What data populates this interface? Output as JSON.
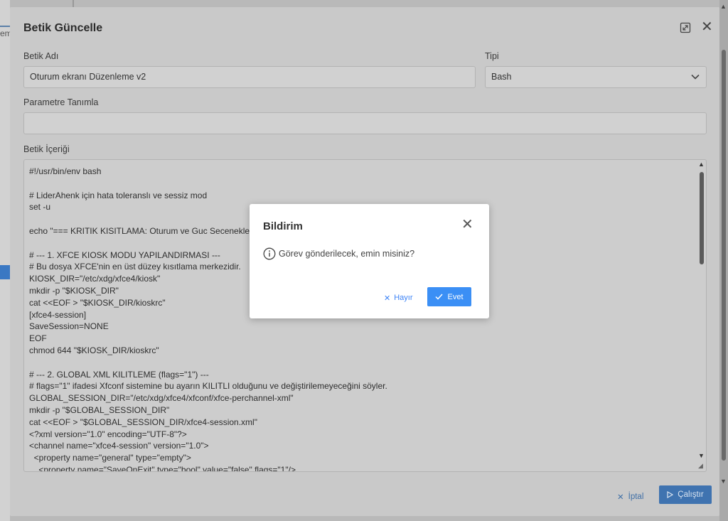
{
  "background": {
    "partial_text": "em"
  },
  "dialog": {
    "title": "Betik Güncelle",
    "name_label": "Betik Adı",
    "name_value": "Oturum ekranı Düzenleme v2",
    "type_label": "Tipi",
    "type_value": "Bash",
    "param_label": "Parametre Tanımla",
    "param_value": "",
    "content_label": "Betik İçeriği",
    "content": "#!/usr/bin/env bash\n\n# LiderAhenk için hata toleranslı ve sessiz mod\nset -u\n\necho \"=== KRITIK KISITLAMA: Oturum ve Guc Secenekleri\n\n# --- 1. XFCE KIOSK MODU YAPILANDIRMASI ---\n# Bu dosya XFCE'nin en üst düzey kısıtlama merkezidir.\nKIOSK_DIR=\"/etc/xdg/xfce4/kiosk\"\nmkdir -p \"$KIOSK_DIR\"\ncat <<EOF > \"$KIOSK_DIR/kioskrc\"\n[xfce4-session]\nSaveSession=NONE\nEOF\nchmod 644 \"$KIOSK_DIR/kioskrc\"\n\n# --- 2. GLOBAL XML KILITLEME (flags=\"1\") ---\n# flags=\"1\" ifadesi Xfconf sistemine bu ayarın KILITLI olduğunu ve değiştirilemeyeceğini söyler.\nGLOBAL_SESSION_DIR=\"/etc/xdg/xfce4/xfconf/xfce-perchannel-xml\"\nmkdir -p \"$GLOBAL_SESSION_DIR\"\ncat <<EOF > \"$GLOBAL_SESSION_DIR/xfce4-session.xml\"\n<?xml version=\"1.0\" encoding=\"UTF-8\"?>\n<channel name=\"xfce4-session\" version=\"1.0\">\n  <property name=\"general\" type=\"empty\">\n    <property name=\"SaveOnExit\" type=\"bool\" value=\"false\" flags=\"1\"/>",
    "cancel_label": "İptal",
    "run_label": "Çalıştır"
  },
  "notification": {
    "title": "Bildirim",
    "message": "Görev gönderilecek, emin misiniz?",
    "no_label": "Hayır",
    "yes_label": "Evet"
  },
  "colors": {
    "primary": "#3b8ff5",
    "overlay": "#8a8a8a"
  },
  "icons": [
    "expand-icon",
    "close-icon",
    "chevron-down-icon",
    "info-icon",
    "x-icon",
    "check-icon",
    "play-icon"
  ]
}
